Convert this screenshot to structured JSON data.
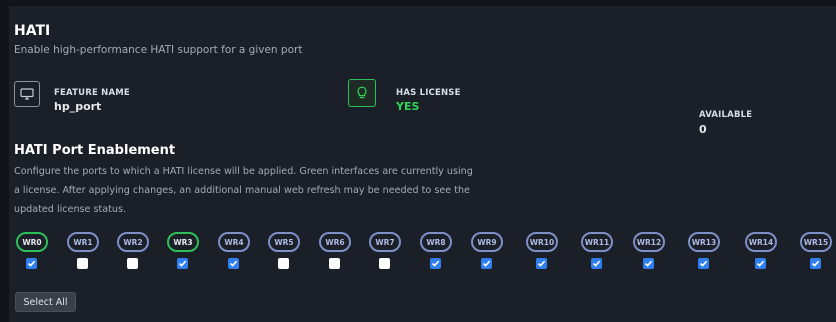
{
  "hati": {
    "title": "HATI",
    "subtitle": "Enable high-performance HATI support for a given port"
  },
  "features": [
    {
      "label": "FEATURE NAME",
      "value": "hp_port",
      "icon": "monitor-icon"
    },
    {
      "label": "HAS LICENSE",
      "value": "YES",
      "icon": "lightbulb-icon",
      "value_color": "#2fd35a"
    },
    {
      "label": "AVAILABLE",
      "value": "0"
    }
  ],
  "port_enablement": {
    "title": "HATI Port Enablement",
    "description": "Configure the ports to which a HATI license will be applied. Green interfaces are currently using a license. After applying changes, an additional manual web refresh may be needed to see the updated license status."
  },
  "ports": [
    {
      "label": "WR0",
      "checked": true,
      "licensed": true
    },
    {
      "label": "WR1",
      "checked": false,
      "licensed": false
    },
    {
      "label": "WR2",
      "checked": false,
      "licensed": false
    },
    {
      "label": "WR3",
      "checked": true,
      "licensed": true
    },
    {
      "label": "WR4",
      "checked": true,
      "licensed": false
    },
    {
      "label": "WR5",
      "checked": false,
      "licensed": false
    },
    {
      "label": "WR6",
      "checked": false,
      "licensed": false
    },
    {
      "label": "WR7",
      "checked": false,
      "licensed": false
    },
    {
      "label": "WR8",
      "checked": true,
      "licensed": false
    },
    {
      "label": "WR9",
      "checked": true,
      "licensed": false
    },
    {
      "label": "WR10",
      "checked": true,
      "licensed": false
    },
    {
      "label": "WR11",
      "checked": true,
      "licensed": false
    },
    {
      "label": "WR12",
      "checked": true,
      "licensed": false
    },
    {
      "label": "WR13",
      "checked": true,
      "licensed": false
    },
    {
      "label": "WR14",
      "checked": true,
      "licensed": false
    },
    {
      "label": "WR15",
      "checked": true,
      "licensed": false
    }
  ],
  "actions": {
    "select_all_label": "Select All"
  }
}
